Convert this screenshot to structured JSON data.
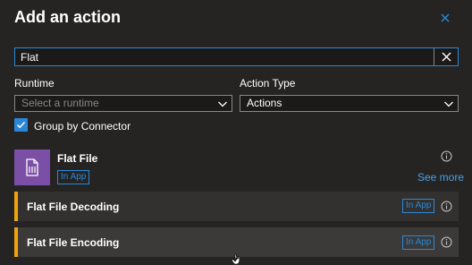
{
  "header": {
    "title": "Add an action"
  },
  "search": {
    "value": "Flat"
  },
  "filters": {
    "runtime": {
      "label": "Runtime",
      "placeholder": "Select a runtime"
    },
    "action_type": {
      "label": "Action Type",
      "value": "Actions"
    }
  },
  "group_by_connector": {
    "label": "Group by Connector",
    "checked": true
  },
  "connector": {
    "name": "Flat File",
    "badge": "In App",
    "see_more": "See more",
    "icon": "flat-file-icon",
    "icon_color": "#7b4fa6"
  },
  "actions": [
    {
      "name": "Flat File Decoding",
      "badge": "In App"
    },
    {
      "name": "Flat File Encoding",
      "badge": "In App"
    }
  ],
  "colors": {
    "background": "#252423",
    "accent": "#2b88d8",
    "action_marker": "#f0a30a"
  }
}
